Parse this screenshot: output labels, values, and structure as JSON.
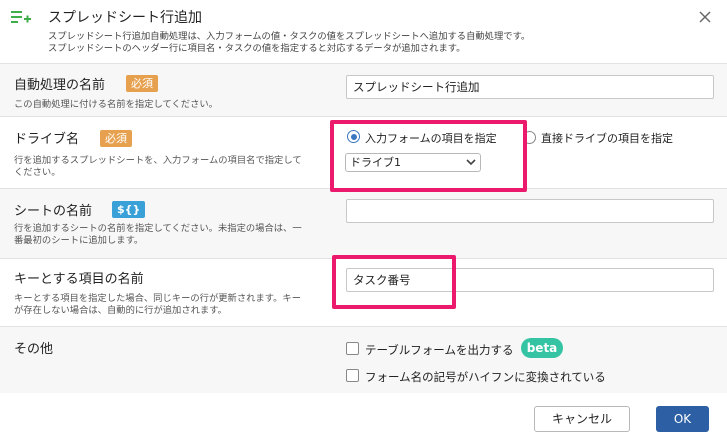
{
  "dialog": {
    "title": "スプレッドシート行追加",
    "desc1": "スプレッドシート行追加自動処理は、入力フォームの値・タスクの値をスプレッドシートへ追加する自動処理です。",
    "desc2": "スプレッドシートのヘッダー行に項目名・タスクの値を指定すると対応するデータが追加されます。"
  },
  "fields": {
    "name": {
      "label": "自動処理の名前",
      "required": "必須",
      "hint": "この自動処理に付ける名前を指定してください。",
      "value": "スプレッドシート行追加"
    },
    "drive": {
      "label": "ドライブ名",
      "required": "必須",
      "hint1": "行を追加するスプレッドシートを、入力フォームの項目名で指定して",
      "hint2": "ください。",
      "radio_form": "入力フォームの項目を指定",
      "radio_direct": "直接ドライブの項目を指定",
      "selected_option": "ドライブ1"
    },
    "sheet": {
      "label": "シートの名前",
      "badge": "${}",
      "hint1": "行を追加するシートの名前を指定してください。未指定の場合は、一",
      "hint2": "番最初のシートに追加します。",
      "value": ""
    },
    "key": {
      "label": "キーとする項目の名前",
      "hint1": "キーとする項目を指定した場合、同じキーの行が更新されます。キー",
      "hint2": "が存在しない場合は、自動的に行が追加されます。",
      "value": "タスク番号"
    },
    "other": {
      "label": "その他",
      "check_table": "テーブルフォームを出力する",
      "beta": "beta",
      "check_hyphen": "フォーム名の記号がハイフンに変換されている"
    }
  },
  "footer": {
    "cancel": "キャンセル",
    "ok": "OK"
  },
  "colors": {
    "required_badge": "#e6a04e",
    "script_badge": "#3aa0d8",
    "beta_badge": "#34c4a4",
    "ok_button": "#2c5fa3",
    "highlight": "#ec1a6c"
  }
}
